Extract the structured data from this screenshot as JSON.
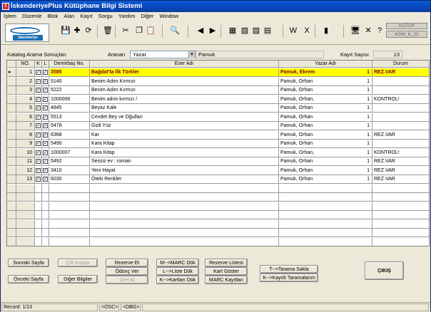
{
  "window": {
    "title": "İskenderiyePlus Kütüphane Bilgi Sistemi",
    "app_icon": "İ"
  },
  "menu": [
    "İşlem",
    "Düzenle",
    "Blok",
    "Alan",
    "Kayıt",
    "Sorgu",
    "Yardım",
    "Diğer",
    "Window"
  ],
  "toolbar": {
    "logo_text": "İskenderiye",
    "kutup": "KUTUP",
    "kgm": "KGM_K_20",
    "icons": [
      "save-icon",
      "add-icon",
      "refresh-icon",
      "delete-icon",
      "cut-icon",
      "copy-icon",
      "paste-icon",
      "search-icon",
      "prev-icon",
      "next-icon",
      "doc1-icon",
      "doc2-icon",
      "doc3-icon",
      "doc4-icon",
      "word-icon",
      "excel-icon",
      "book-icon",
      "pc-icon",
      "tools-icon",
      "help-icon"
    ],
    "glyphs": [
      "💾",
      "✚",
      "⟳",
      "🗑",
      "✂",
      "❐",
      "📋",
      "🔍",
      "◀",
      "▶",
      "▦",
      "▧",
      "▨",
      "▤",
      "W",
      "X",
      "▮",
      "🖥",
      "✕",
      "?"
    ]
  },
  "search": {
    "title": "Katalog Arama Sonuçları",
    "aranan_label": "Aranan",
    "field": "Yazar",
    "value": "Pamuk",
    "count_label": "Kayıt Sayısı",
    "count": "13"
  },
  "grid": {
    "columns": {
      "no": "NO.",
      "k": "K",
      "l": "L",
      "demirbas": "Demirbaş No.",
      "eser": "Eser Adı",
      "yazar": "Yazar Adı",
      "durum": "Durum"
    },
    "rows": [
      {
        "no": "1",
        "dem": "3585",
        "eser": "Bağdat'ta İlk Türkler",
        "yazar": "Pamuk, Ekrem",
        "adet": "1",
        "durum": "REZ.VAR"
      },
      {
        "no": "2",
        "dem": "5140",
        "eser": "Benim Adım Kırmızı",
        "yazar": "Pamuk, Orhan",
        "adet": "1",
        "durum": ""
      },
      {
        "no": "3",
        "dem": "5222",
        "eser": "Benim Adım Kırmızı",
        "yazar": "Pamuk, Orhan",
        "adet": "1",
        "durum": ""
      },
      {
        "no": "4",
        "dem": "1000006",
        "eser": "Benim adım kırmızı /",
        "yazar": "Pamuk, Orhan,",
        "adet": "1",
        "durum": "KONTROL!"
      },
      {
        "no": "5",
        "dem": "4845",
        "eser": "Beyaz Kale",
        "yazar": "Pamuk, Orhan",
        "adet": "1",
        "durum": ""
      },
      {
        "no": "6",
        "dem": "5513",
        "eser": "Cevdet Bey ve Oğulları",
        "yazar": "Pamuk, Orhan",
        "adet": "1",
        "durum": ""
      },
      {
        "no": "7",
        "dem": "5478",
        "eser": "Gizli Yüz",
        "yazar": "Pamuk, Orhan",
        "adet": "1",
        "durum": ""
      },
      {
        "no": "8",
        "dem": "6368",
        "eser": "Kar",
        "yazar": "Pamuk, Orhan",
        "adet": "1",
        "durum": "REZ.VAR"
      },
      {
        "no": "9",
        "dem": "5490",
        "eser": "Kara Kitap",
        "yazar": "Pamuk, Orhan",
        "adet": "1",
        "durum": ""
      },
      {
        "no": "10",
        "dem": "1000007",
        "eser": "Kara Kitap",
        "yazar": "Pamuk, Orhan,",
        "adet": "1",
        "durum": "KONTROL!"
      },
      {
        "no": "11",
        "dem": "5492",
        "eser": "Sessiz ev : roman",
        "yazar": "Pamuk, Orhan",
        "adet": "1",
        "durum": "REZ.VAR"
      },
      {
        "no": "12",
        "dem": "3410",
        "eser": "Yeni Hayat",
        "yazar": "Pamuk, Orhan",
        "adet": "1",
        "durum": "REZ.VAR"
      },
      {
        "no": "13",
        "dem": "6030",
        "eser": "Öteki Renkler",
        "yazar": "Pamuk, Orhan",
        "adet": "1",
        "durum": "REZ.VAR"
      }
    ],
    "check_mark": "✓",
    "row_indicator": "▸"
  },
  "buttons": {
    "sonraki": "Sonraki Sayfa",
    "onceki": "Önceki Sayfa",
    "cift": "Çift Kopya",
    "diger": "Diğer Bilgiler",
    "rezerve": "Rezerve Et",
    "odunc": "Ödünç Ver",
    "geri": "Geri Al",
    "marc_dok": "M-->MARC Dök",
    "liste_dok": "L-->Liste Dök",
    "kart_dok": "K-->Kartları Dök",
    "rez_liste": "Rezerve Listesi",
    "kart_goster": "Kart Göster",
    "marc_kayit": "MARC Kayıtları",
    "tarama_sakla": "T-->Tarama Sakla",
    "kayitli": "K-->Kayıtlı Taramalarım",
    "cikis": "ÇIKIŞ"
  },
  "status": {
    "record": "Record: 1/13",
    "osc": "<OSC>",
    "dbg": "<DBG>"
  }
}
